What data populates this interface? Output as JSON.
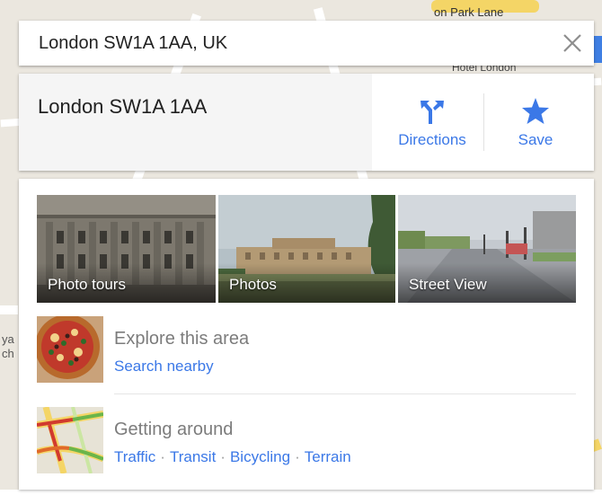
{
  "search": {
    "value": "London SW1A 1AA, UK",
    "close_symbol": "✕"
  },
  "place": {
    "title": "London SW1A 1AA",
    "directions_label": "Directions",
    "save_label": "Save"
  },
  "photos": [
    {
      "label": "Photo tours"
    },
    {
      "label": "Photos"
    },
    {
      "label": "Street View"
    }
  ],
  "explore": {
    "title": "Explore this area",
    "link": "Search nearby"
  },
  "getting_around": {
    "title": "Getting around",
    "links": [
      "Traffic",
      "Transit",
      "Bicycling",
      "Terrain"
    ],
    "separator": "·"
  },
  "map_labels": {
    "top_right": "on Park Lane",
    "top_right_2": "Hotel London",
    "left_edge": "ya",
    "left_edge_2": "ch"
  },
  "colors": {
    "accent": "#3b78e7",
    "muted_text": "#7c7c7c",
    "title_text": "#212121"
  }
}
